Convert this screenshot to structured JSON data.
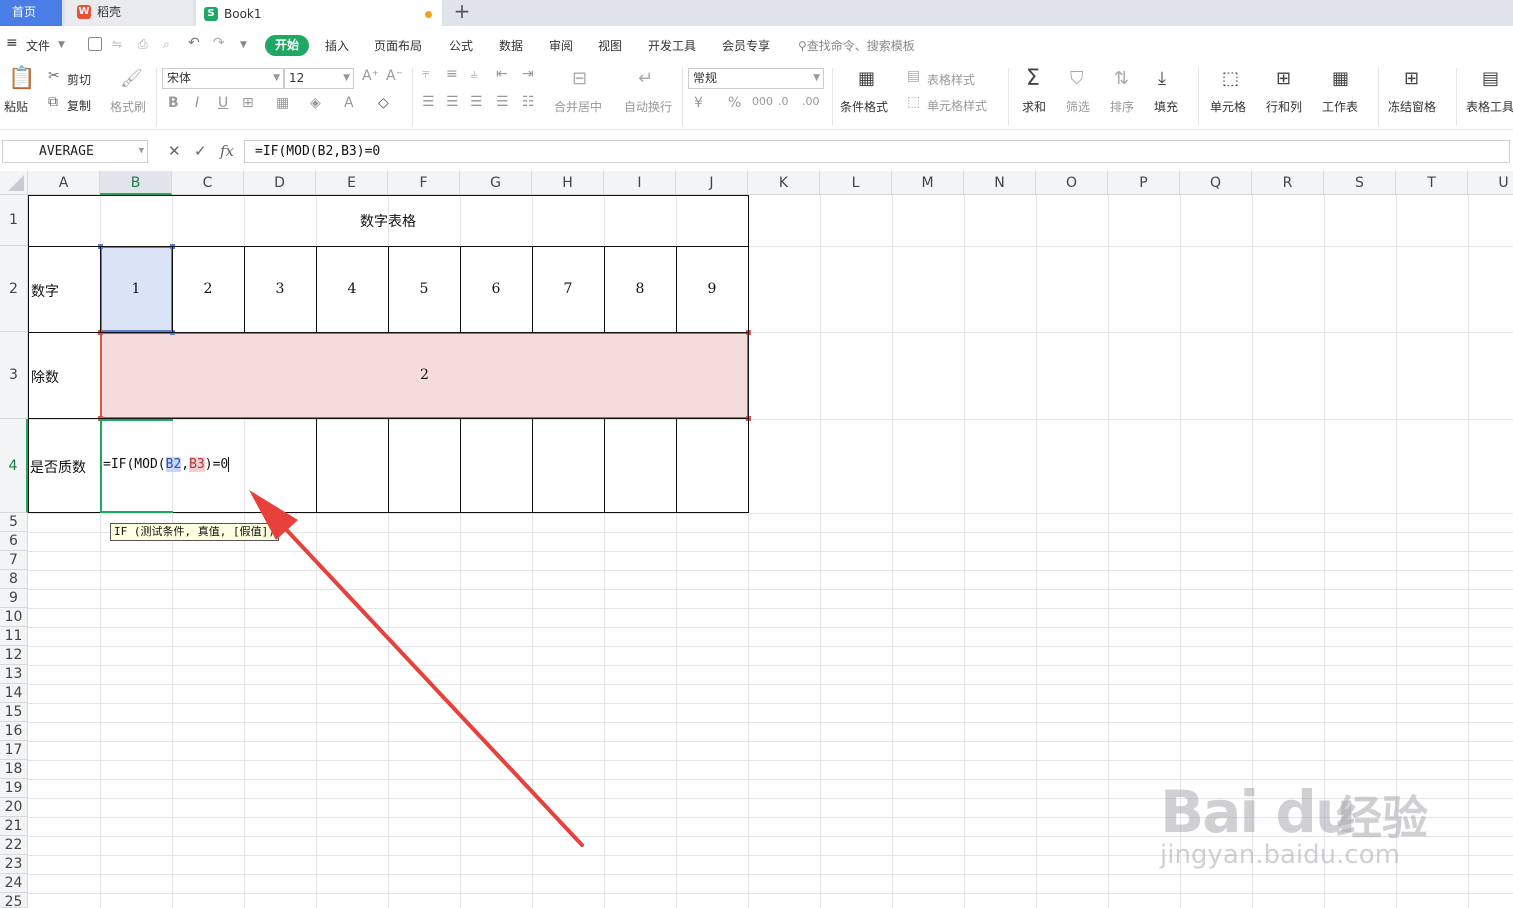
{
  "tabs": {
    "home": "首页",
    "daoke": "稻壳",
    "book": "Book1",
    "new_tab": "+"
  },
  "menu": {
    "file": "文件",
    "items": [
      "开始",
      "插入",
      "页面布局",
      "公式",
      "数据",
      "审阅",
      "视图",
      "开发工具",
      "会员专享"
    ],
    "search": "查找命令、搜索模板"
  },
  "ribbon": {
    "paste": "粘贴",
    "cut": "剪切",
    "copy": "复制",
    "format_painter": "格式刷",
    "font_name": "宋体",
    "font_size": "12",
    "merge_center": "合并居中",
    "wrap": "自动换行",
    "number_format": "常规",
    "cond_format": "条件格式",
    "table_style": "表格样式",
    "cell_style": "单元格样式",
    "sum": "求和",
    "filter": "筛选",
    "sort": "排序",
    "fill": "填充",
    "cell": "单元格",
    "row_col": "行和列",
    "worksheet": "工作表",
    "freeze": "冻结窗格",
    "table_tools": "表格工具"
  },
  "formula_bar": {
    "name_box": "AVERAGE",
    "fx": "fx",
    "formula": "=IF(MOD(B2,B3)=0"
  },
  "columns": [
    "A",
    "B",
    "C",
    "D",
    "E",
    "F",
    "G",
    "H",
    "I",
    "J",
    "K",
    "L",
    "M",
    "N",
    "O",
    "P",
    "Q",
    "R",
    "S",
    "T",
    "U"
  ],
  "rows": [
    "1",
    "2",
    "3",
    "4",
    "5",
    "6",
    "7",
    "8",
    "9",
    "10",
    "11",
    "12",
    "13",
    "14",
    "15",
    "16",
    "17",
    "18",
    "19",
    "20",
    "21",
    "22",
    "23",
    "24",
    "25"
  ],
  "sheet": {
    "title": "数字表格",
    "row2_label": "数字",
    "numbers": [
      "1",
      "2",
      "3",
      "4",
      "5",
      "6",
      "7",
      "8",
      "9"
    ],
    "row3_label": "除数",
    "divisor": "2",
    "row4_label": "是否质数",
    "editing": {
      "prefix": "=IF(MOD(",
      "ref1": "B2",
      "sep": ",",
      "ref2": "B3",
      "suffix": ")=0"
    },
    "tooltip": "IF (测试条件, 真值, [假值])"
  },
  "watermark": {
    "logo": "Bai du",
    "cn": "经验",
    "url": "jingyan.baidu.com"
  },
  "colors": {
    "accent": "#1fa864",
    "ref_blue": "#5b7fd6",
    "ref_red": "#d9534f",
    "arrow": "#e8403a"
  }
}
